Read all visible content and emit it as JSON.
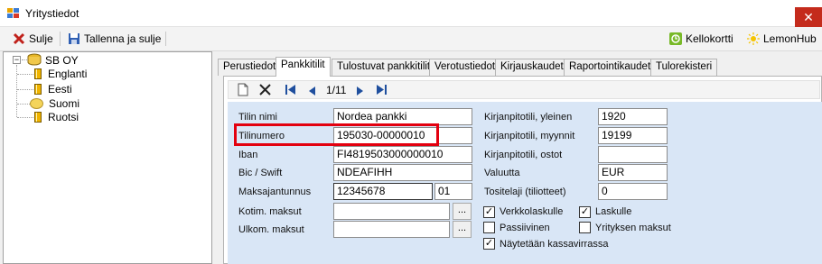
{
  "window": {
    "title": "Yritystiedot",
    "close_glyph": "✕"
  },
  "toolbar": {
    "close_label": "Sulje",
    "save_close_label": "Tallenna ja sulje",
    "kellokortti_label": "Kellokortti",
    "lemonhub_label": "LemonHub"
  },
  "tree": {
    "root": "SB OY",
    "expander": "−",
    "children": [
      "Englanti",
      "Eesti",
      "Suomi",
      "Ruotsi"
    ]
  },
  "tabs": [
    "Perustiedot",
    "Pankkitilit",
    "Tulostuvat pankkitilit",
    "Verotustiedot",
    "Kirjauskaudet",
    "Raportointikaudet",
    "Tulorekisteri"
  ],
  "active_tab": "Pankkitilit",
  "navigator": {
    "position": "1/11"
  },
  "form": {
    "labels": {
      "tilin_nimi": "Tilin nimi",
      "tilinumero": "Tilinumero",
      "iban": "Iban",
      "bic": "Bic / Swift",
      "maksajantunnus": "Maksajantunnus",
      "kotim": "Kotim. maksut",
      "ulkom": "Ulkom. maksut",
      "kp_yleinen": "Kirjanpitotili, yleinen",
      "kp_myynnit": "Kirjanpitotili, myynnit",
      "kp_ostot": "Kirjanpitotili, ostot",
      "valuutta": "Valuutta",
      "tositelaji": "Tositelaji (tiliotteet)"
    },
    "values": {
      "tilin_nimi": "Nordea pankki",
      "tilinumero": "195030-00000010",
      "iban": "FI4819503000000010",
      "bic": "NDEAFIHH",
      "maksajantunnus": "12345678",
      "maksajantunnus_suffix": "01",
      "kotim": "",
      "ulkom": "",
      "kp_yleinen": "1920",
      "kp_myynnit": "19199",
      "kp_ostot": "",
      "valuutta": "EUR",
      "tositelaji": "0"
    },
    "browse_label": "...",
    "checkboxes": {
      "verkkolaskulle": {
        "label": "Verkkolaskulle",
        "checked": true
      },
      "laskulle": {
        "label": "Laskulle",
        "checked": true
      },
      "passiivinen": {
        "label": "Passiivinen",
        "checked": false
      },
      "yrityksen_maksut": {
        "label": "Yrityksen maksut",
        "checked": false
      },
      "kassavirta": {
        "label": "Näytetään kassavirrassa",
        "checked": true
      }
    },
    "check_glyph": "✓"
  },
  "colors": {
    "form_bg": "#d9e6f6",
    "highlight": "#e3000f",
    "close_bg": "#c42b1c"
  }
}
